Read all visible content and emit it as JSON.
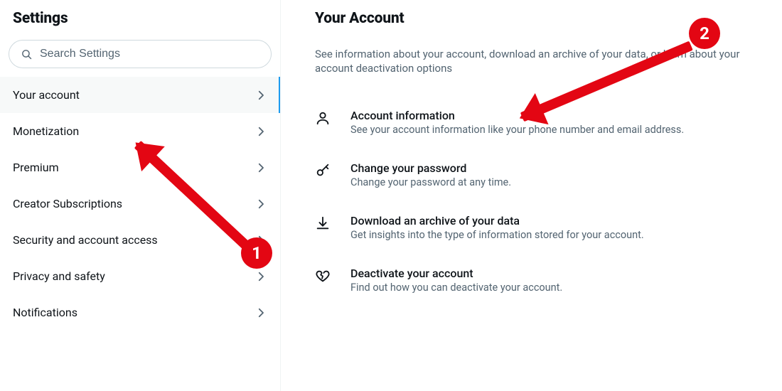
{
  "sidebar": {
    "title": "Settings",
    "search_placeholder": "Search Settings",
    "items": [
      {
        "label": "Your account",
        "active": true
      },
      {
        "label": "Monetization"
      },
      {
        "label": "Premium"
      },
      {
        "label": "Creator Subscriptions"
      },
      {
        "label": "Security and account access"
      },
      {
        "label": "Privacy and safety"
      },
      {
        "label": "Notifications"
      }
    ]
  },
  "main": {
    "title": "Your Account",
    "subtitle": "See information about your account, download an archive of your data, or learn about your account deactivation options",
    "options": [
      {
        "title": "Account information",
        "desc": "See your account information like your phone number and email address."
      },
      {
        "title": "Change your password",
        "desc": "Change your password at any time."
      },
      {
        "title": "Download an archive of your data",
        "desc": "Get insights into the type of information stored for your account."
      },
      {
        "title": "Deactivate your account",
        "desc": "Find out how you can deactivate your account."
      }
    ]
  },
  "annotations": {
    "step1": "1",
    "step2": "2"
  }
}
